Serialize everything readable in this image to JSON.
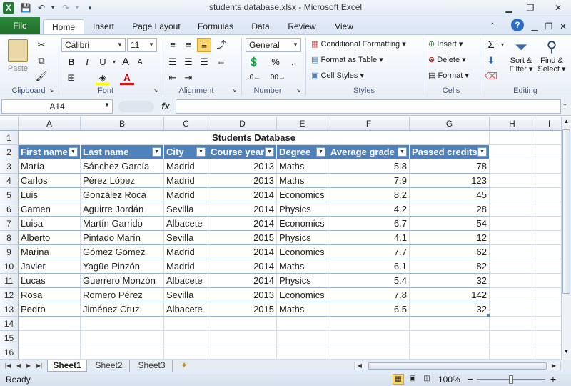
{
  "window": {
    "title": "students database.xlsx - Microsoft Excel"
  },
  "tabs": [
    "File",
    "Home",
    "Insert",
    "Page Layout",
    "Formulas",
    "Data",
    "Review",
    "View"
  ],
  "ribbon": {
    "clipboard": {
      "label": "Clipboard",
      "paste": "Paste"
    },
    "font": {
      "label": "Font",
      "name": "Calibri",
      "size": "11",
      "bold": "B",
      "italic": "I",
      "underline": "U"
    },
    "alignment": {
      "label": "Alignment"
    },
    "number": {
      "label": "Number",
      "format": "General",
      "percent": "%",
      "comma": ","
    },
    "styles": {
      "label": "Styles",
      "conditional": "Conditional Formatting",
      "format_table": "Format as Table",
      "cell_styles": "Cell Styles"
    },
    "cells": {
      "label": "Cells",
      "insert": "Insert",
      "delete": "Delete",
      "format": "Format"
    },
    "editing": {
      "label": "Editing",
      "sigma": "Σ",
      "sort_filter": "Sort &",
      "sort_filter2": "Filter",
      "find_select": "Find &",
      "find_select2": "Select"
    }
  },
  "formula_bar": {
    "name_box": "A14",
    "fx": "fx",
    "value": ""
  },
  "columns": [
    "A",
    "B",
    "C",
    "D",
    "E",
    "F",
    "G",
    "H",
    "I"
  ],
  "rows": [
    "1",
    "2",
    "3",
    "4",
    "5",
    "6",
    "7",
    "8",
    "9",
    "10",
    "11",
    "12",
    "13",
    "14",
    "15",
    "16"
  ],
  "sheet_title": "Students Database",
  "table": {
    "headers": [
      "First name",
      "Last name",
      "City",
      "Course year",
      "Degree",
      "Average grade",
      "Passed credits"
    ],
    "rows": [
      [
        "María",
        "Sánchez García",
        "Madrid",
        "2013",
        "Maths",
        "5.8",
        "78"
      ],
      [
        "Carlos",
        "Pérez López",
        "Madrid",
        "2013",
        "Maths",
        "7.9",
        "123"
      ],
      [
        "Luis",
        "González Roca",
        "Madrid",
        "2014",
        "Economics",
        "8.2",
        "45"
      ],
      [
        "Camen",
        "Aguirre Jordán",
        "Sevilla",
        "2014",
        "Physics",
        "4.2",
        "28"
      ],
      [
        "Luisa",
        "Martín Garrido",
        "Albacete",
        "2014",
        "Economics",
        "6.7",
        "54"
      ],
      [
        "Alberto",
        "Pintado Marín",
        "Sevilla",
        "2015",
        "Physics",
        "4.1",
        "12"
      ],
      [
        "Marina",
        "Gómez Gómez",
        "Madrid",
        "2014",
        "Economics",
        "7.7",
        "62"
      ],
      [
        "Javier",
        "Yagüe Pinzón",
        "Madrid",
        "2014",
        "Maths",
        "6.1",
        "82"
      ],
      [
        "Lucas",
        "Guerrero Monzón",
        "Albacete",
        "2014",
        "Physics",
        "5.4",
        "32"
      ],
      [
        "Rosa",
        "Romero Pérez",
        "Sevilla",
        "2013",
        "Economics",
        "7.8",
        "142"
      ],
      [
        "Pedro",
        "Jiménez Cruz",
        "Albacete",
        "2015",
        "Maths",
        "6.5",
        "32"
      ]
    ]
  },
  "sheets": [
    "Sheet1",
    "Sheet2",
    "Sheet3"
  ],
  "status": {
    "ready": "Ready",
    "zoom": "100%",
    "minus": "−",
    "plus": "+"
  },
  "colors": {
    "header_blue": "#4f81bd",
    "file_green": "#217346"
  }
}
